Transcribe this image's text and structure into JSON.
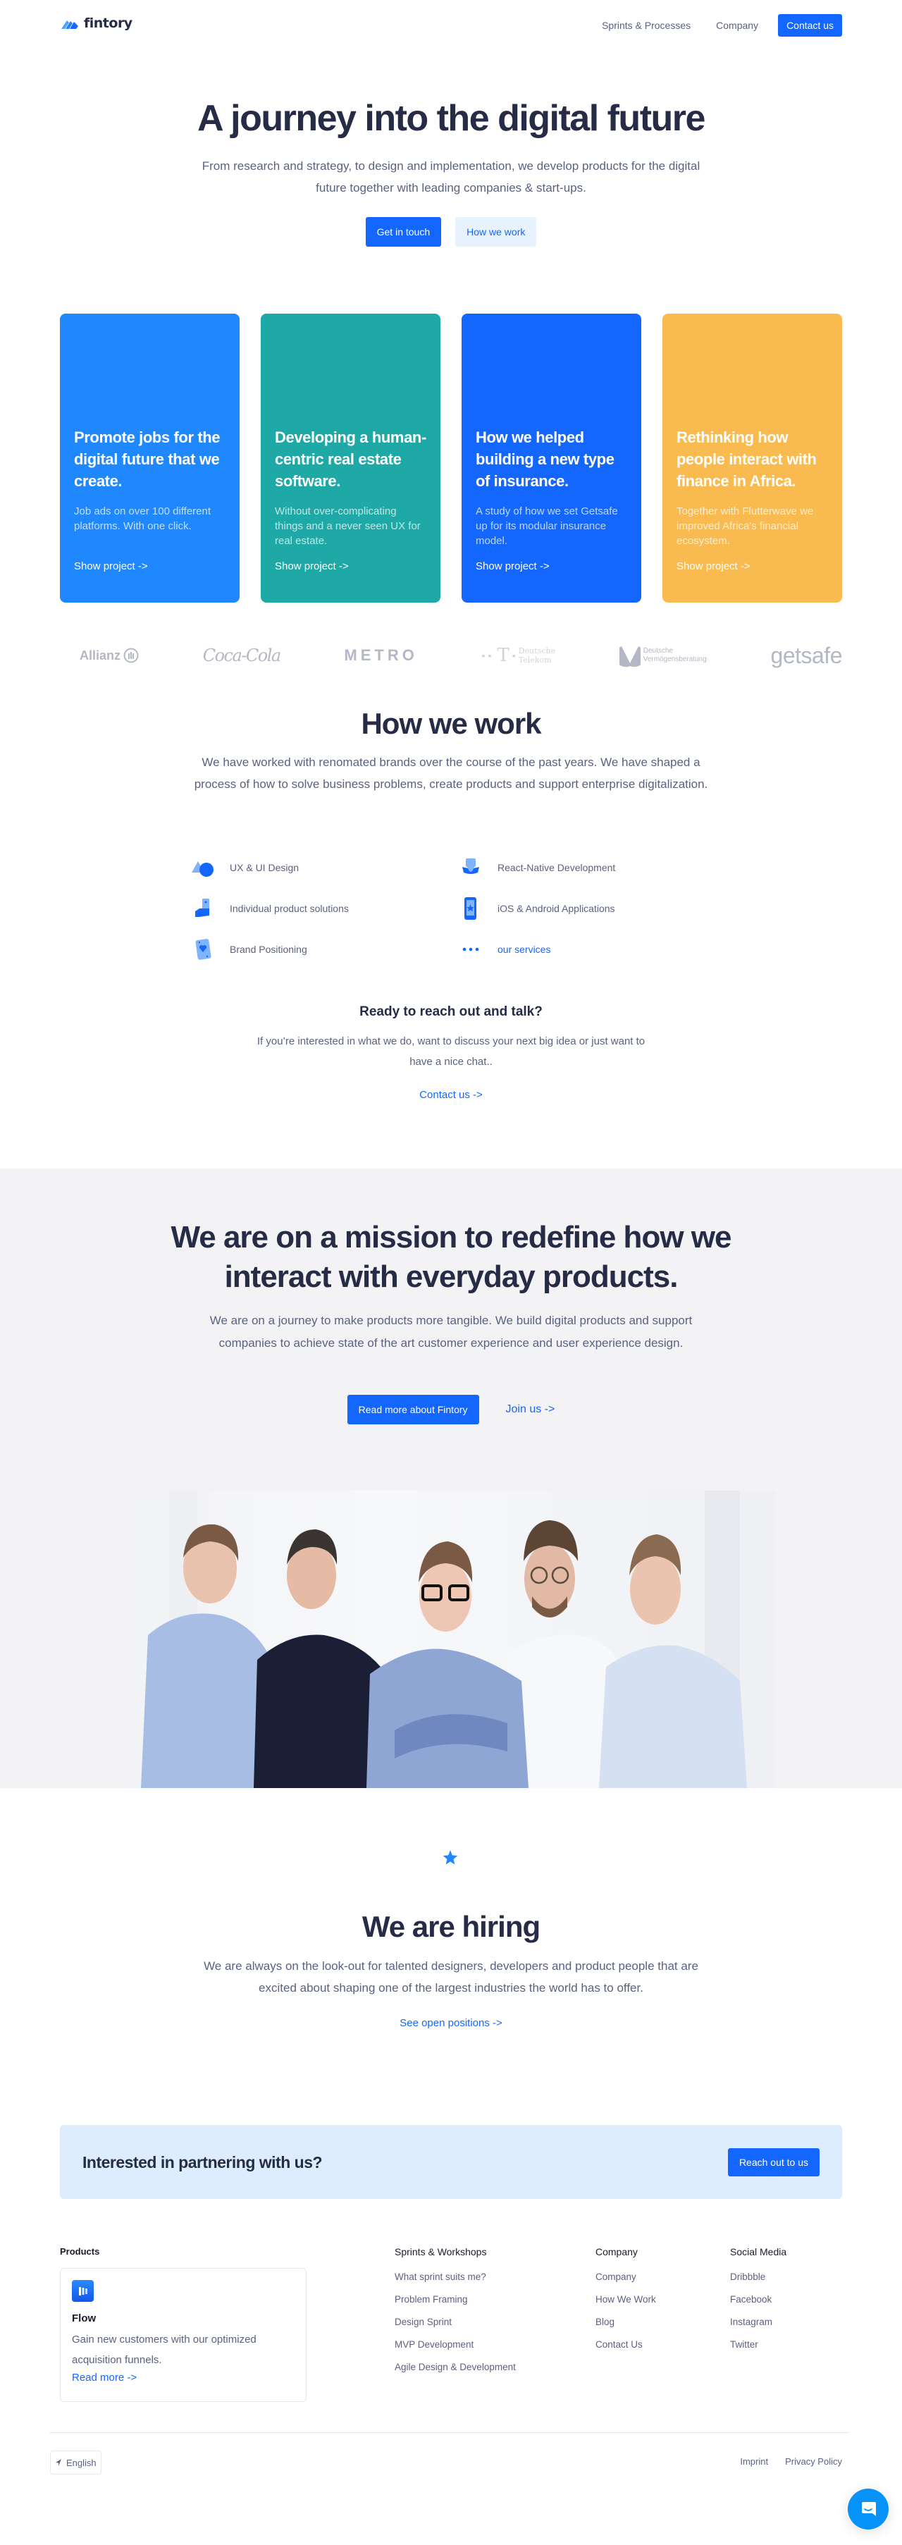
{
  "nav": {
    "logo_text": "fintory",
    "links": [
      "Sprints & Processes",
      "Company"
    ],
    "cta": "Contact us"
  },
  "hero": {
    "title": "A journey into the digital future",
    "subtitle": "From research and strategy, to design and implementation, we develop products for the digital future together with leading companies & start-ups.",
    "primary_button": "Get in touch",
    "secondary_button": "How we work"
  },
  "projects": [
    {
      "title": "Promote jobs for the digital future that we create.",
      "description": "Job ads on over 100 different platforms. With one click.",
      "link": "Show project ->",
      "color": "#2088fe"
    },
    {
      "title": "Developing a human-centric real estate software.",
      "description": "Without over-complicating things and a never seen UX for real estate.",
      "link": "Show project ->",
      "color": "#1fa9a6"
    },
    {
      "title": "How we helped building a new type of insurance.",
      "description": "A study of how we set Getsafe up for its modular insurance model.",
      "link": "Show project ->",
      "color": "#1467fe"
    },
    {
      "title": "Rethinking how people interact with finance in Africa.",
      "description": "Together with Flutterwave we improved Africa's financial ecosystem.",
      "link": "Show project ->",
      "color": "#f9bb4f"
    }
  ],
  "client_logos": {
    "allianz": "Allianz",
    "cocacola": "Coca-Cola",
    "metro": "METRO",
    "telekom_line1": "Deutsche",
    "telekom_line2": "Telekom",
    "dvag_line1": "Deutsche",
    "dvag_line2": "Vermögensberatung",
    "getsafe": "getsafe"
  },
  "how_we_work": {
    "title": "How we work",
    "subtitle": "We have worked with renomated brands over the course of the past years. We have shaped a process of how to solve business problems, create products and support enterprise digitalization.",
    "services": [
      {
        "label": "UX & UI Design",
        "icon": "shapes-icon"
      },
      {
        "label": "React-Native Development",
        "icon": "hat-icon"
      },
      {
        "label": "Individual product solutions",
        "icon": "hand-phone-icon"
      },
      {
        "label": "iOS & Android Applications",
        "icon": "smartphone-star-icon"
      },
      {
        "label": "Brand Positioning",
        "icon": "playing-card-icon"
      },
      {
        "label": "our services",
        "icon": "more-dots-icon"
      }
    ]
  },
  "talk": {
    "title": "Ready to reach out and talk?",
    "subtitle": "If you’re interested in what we do, want to discuss your next big idea or just want to have a nice chat..",
    "link": "Contact us ->"
  },
  "mission": {
    "title": "We are on a mission to redefine how we interact with everyday products.",
    "subtitle": "We are on a journey to make products more tangible. We build digital products and support companies to achieve state of the art customer experience and user experience design.",
    "primary_button": "Read more about Fintory",
    "link": "Join us ->"
  },
  "hiring": {
    "title": "We are hiring",
    "subtitle": "We are always on the look-out for talented designers, developers and product people that are excited about shaping one of the largest industries the world has to offer.",
    "link": "See open positions ->"
  },
  "partner": {
    "text": "Interested in partnering with us?",
    "button": "Reach out to us"
  },
  "footer": {
    "products_heading": "Products",
    "product": {
      "name": "Flow",
      "description": "Gain new customers with our optimized acquisition funnels.",
      "link": "Read more ->"
    },
    "columns": [
      {
        "heading": "Sprints & Workshops",
        "items": [
          "What sprint suits me?",
          "Problem Framing",
          "Design Sprint",
          "MVP Development",
          "Agile Design & Development"
        ]
      },
      {
        "heading": "Company",
        "items": [
          "Company",
          "How We Work",
          "Blog",
          "Contact Us"
        ]
      },
      {
        "heading": "Social Media",
        "items": [
          "Dribbble",
          "Facebook",
          "Instagram",
          "Twitter"
        ]
      }
    ],
    "language": "English",
    "legal": [
      "Imprint",
      "Privacy Policy"
    ]
  },
  "colors": {
    "primary": "#1467fe",
    "heading": "#262b46",
    "body": "#5b6180",
    "mission_bg": "#f3f3f5",
    "partner_bg": "#deedfd"
  }
}
